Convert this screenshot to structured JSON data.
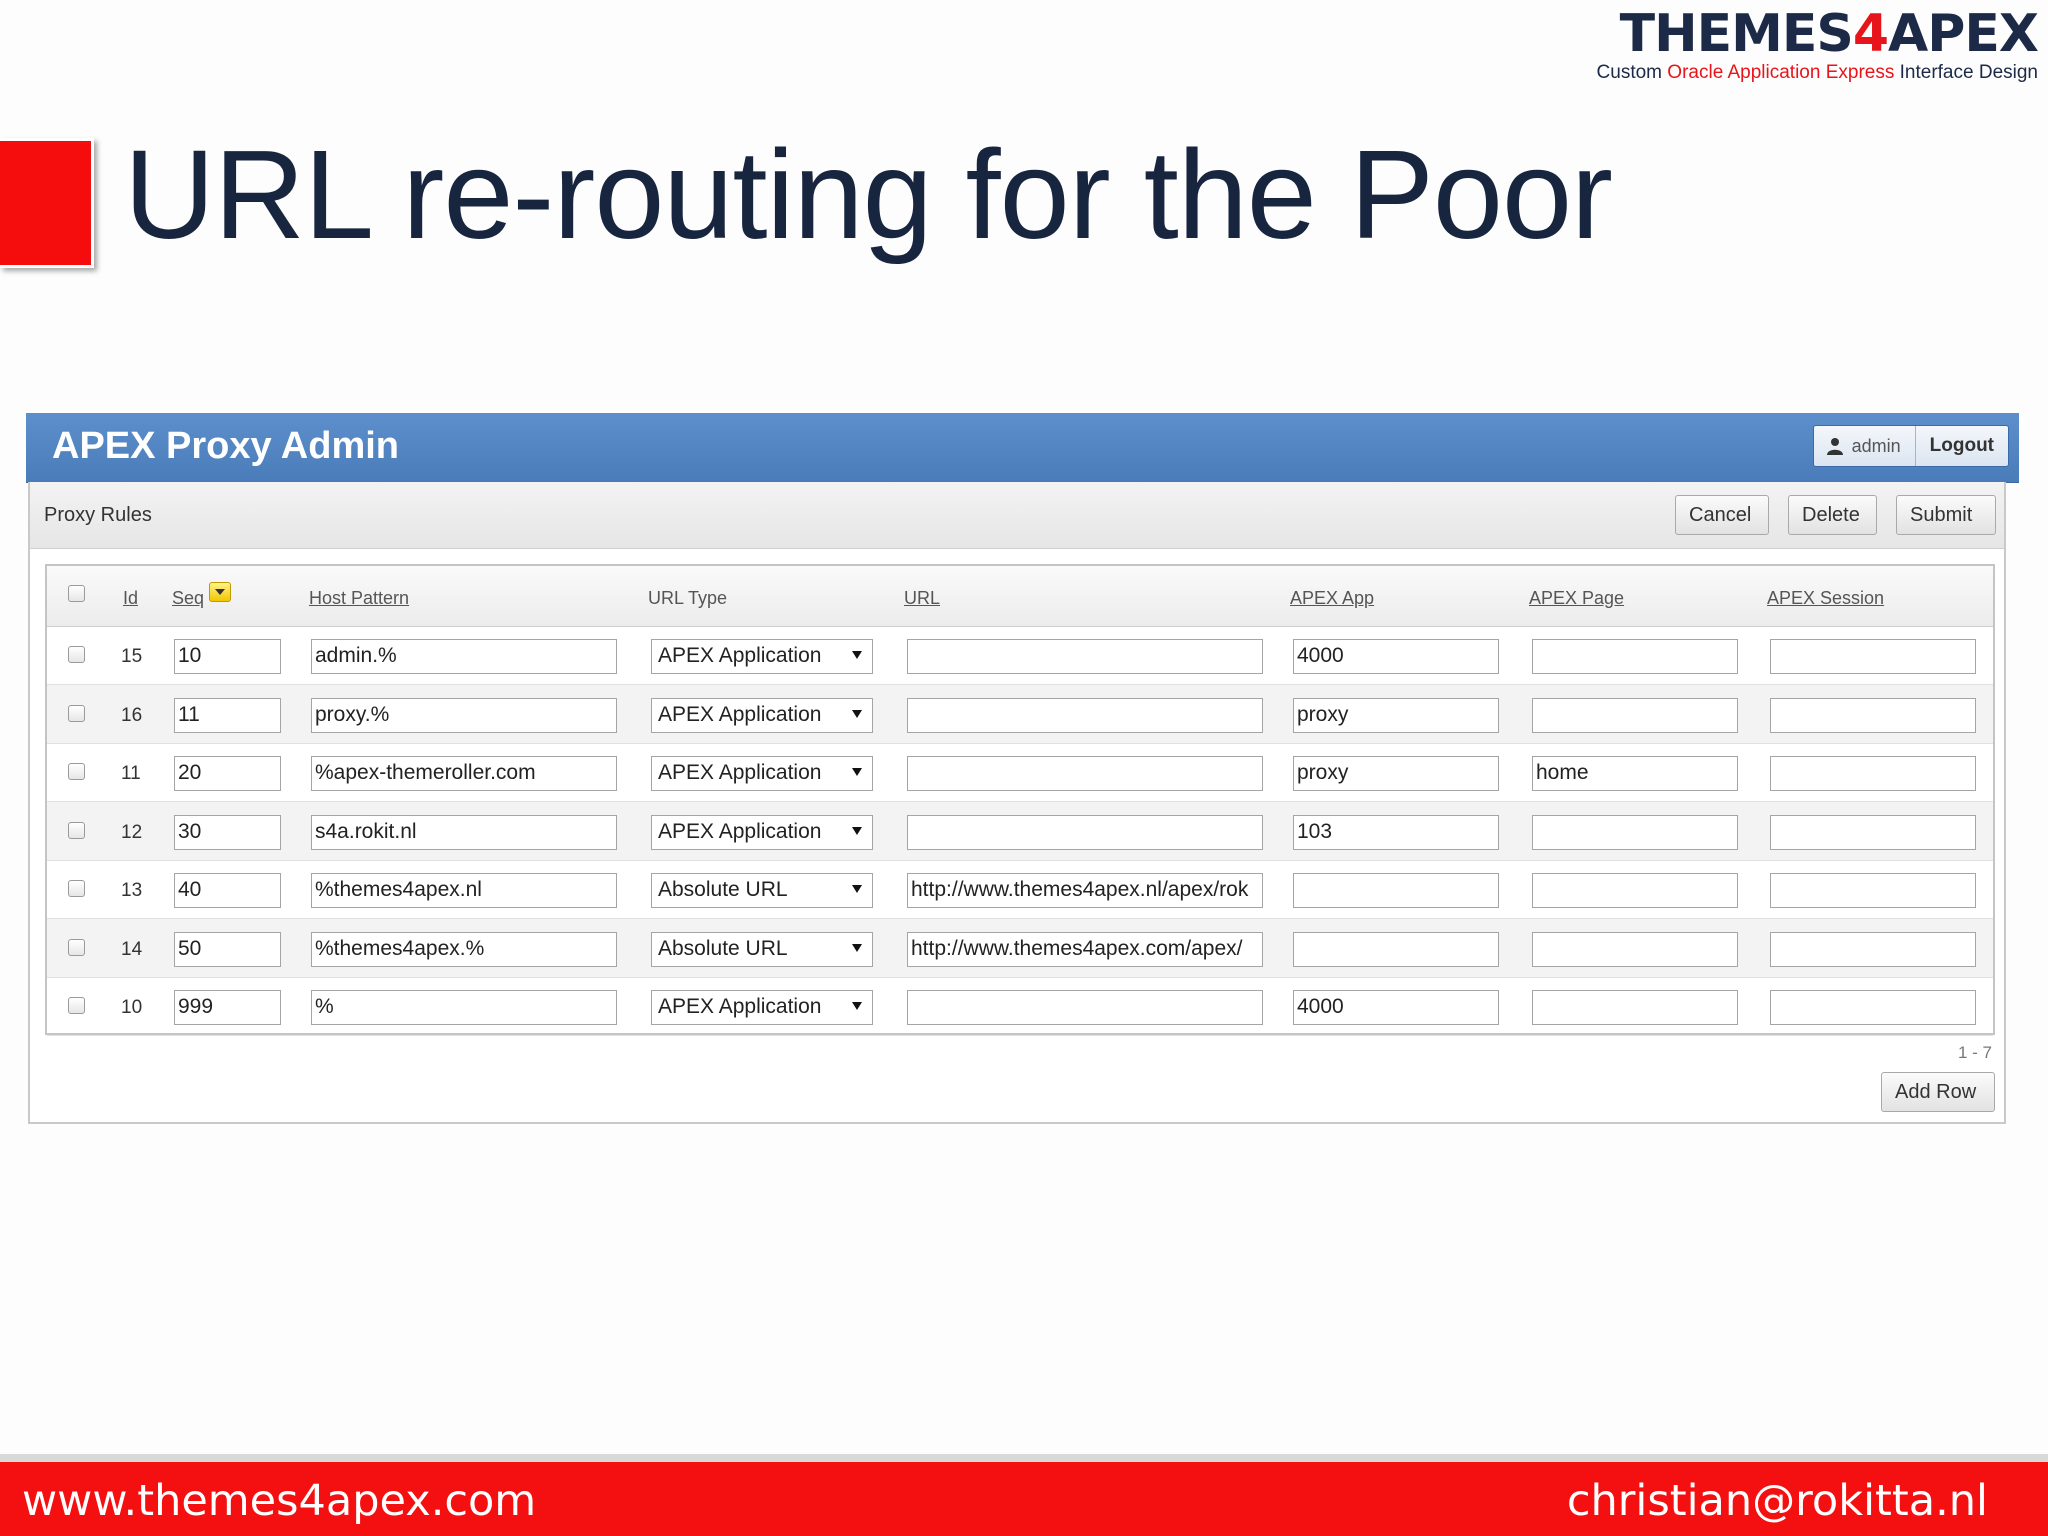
{
  "logo": {
    "word_part1": "THEMES",
    "word_four": "4",
    "word_part2": "APEX",
    "tag_part1": "Custom ",
    "tag_red": "Oracle Application Express",
    "tag_part2": " Interface Design"
  },
  "slide": {
    "title": "URL re-routing for the Poor",
    "footer_left": "www.themes4apex.com",
    "footer_right": "christian@rokitta.nl"
  },
  "app": {
    "title": "APEX Proxy Admin",
    "user": "admin",
    "logout_label": "Logout"
  },
  "region": {
    "title": "Proxy Rules",
    "cancel_label": "Cancel",
    "delete_label": "Delete",
    "submit_label": "Submit",
    "add_row_label": "Add Row",
    "pagination": "1 - 7"
  },
  "columns": {
    "id": "Id",
    "seq": "Seq",
    "host_pattern": "Host Pattern",
    "url_type": "URL Type",
    "url": "URL",
    "apex_app": "APEX App",
    "apex_page": "APEX Page",
    "apex_session": "APEX Session"
  },
  "rows": [
    {
      "id": "15",
      "seq": "10",
      "host": "admin.%",
      "type": "APEX Application",
      "url": "",
      "app": "4000",
      "page": "",
      "session": ""
    },
    {
      "id": "16",
      "seq": "11",
      "host": "proxy.%",
      "type": "APEX Application",
      "url": "",
      "app": "proxy",
      "page": "",
      "session": ""
    },
    {
      "id": "11",
      "seq": "20",
      "host": "%apex-themeroller.com",
      "type": "APEX Application",
      "url": "",
      "app": "proxy",
      "page": "home",
      "session": ""
    },
    {
      "id": "12",
      "seq": "30",
      "host": "s4a.rokit.nl",
      "type": "APEX Application",
      "url": "",
      "app": "103",
      "page": "",
      "session": ""
    },
    {
      "id": "13",
      "seq": "40",
      "host": "%themes4apex.nl",
      "type": "Absolute URL",
      "url": "http://www.themes4apex.nl/apex/rok",
      "app": "",
      "page": "",
      "session": ""
    },
    {
      "id": "14",
      "seq": "50",
      "host": "%themes4apex.%",
      "type": "Absolute URL",
      "url": "http://www.themes4apex.com/apex/",
      "app": "",
      "page": "",
      "session": ""
    },
    {
      "id": "10",
      "seq": "999",
      "host": "%",
      "type": "APEX Application",
      "url": "",
      "app": "4000",
      "page": "",
      "session": ""
    }
  ],
  "icons": {
    "user": "user-icon",
    "sort": "sort-descending-icon",
    "dropdown": "dropdown-arrow-icon"
  },
  "colors": {
    "header_blue": "#4f83c1",
    "brand_red": "#f41010",
    "title_navy": "#17253f"
  }
}
